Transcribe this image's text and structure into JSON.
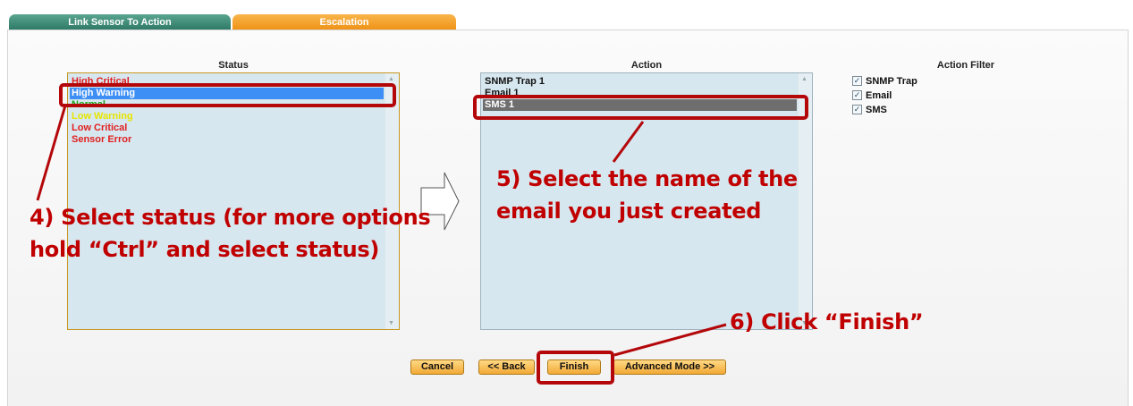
{
  "tabs": [
    {
      "label": "Link Sensor To Action",
      "color": "#3f8f79"
    },
    {
      "label": "Escalation",
      "color": "#f29d24"
    }
  ],
  "status": {
    "header": "Status",
    "items": [
      {
        "label": "High Critical",
        "color": "#e02020",
        "selected": false
      },
      {
        "label": "High Warning",
        "color": "#ffffff",
        "selected": true
      },
      {
        "label": "Normal",
        "color": "#1aa81a",
        "selected": false
      },
      {
        "label": "Low Warning",
        "color": "#e6e600",
        "selected": false
      },
      {
        "label": "Low Critical",
        "color": "#e02020",
        "selected": false
      },
      {
        "label": "Sensor Error",
        "color": "#e02020",
        "selected": false
      }
    ]
  },
  "action": {
    "header": "Action",
    "items": [
      {
        "label": "SNMP Trap 1",
        "selected": false
      },
      {
        "label": "Email 1",
        "selected": false
      },
      {
        "label": "SMS 1",
        "selected": true
      }
    ]
  },
  "action_filter": {
    "header": "Action Filter",
    "options": [
      {
        "label": "SNMP Trap",
        "checked": true
      },
      {
        "label": "Email",
        "checked": true
      },
      {
        "label": "SMS",
        "checked": true
      }
    ]
  },
  "buttons": {
    "cancel": "Cancel",
    "back": "<< Back",
    "finish": "Finish",
    "advanced": "Advanced Mode >>"
  },
  "annotations": {
    "step4_line1": "4) Select status (for more options",
    "step4_line2": "hold “Ctrl” and select status)",
    "step5_line1": "5) Select the name of the",
    "step5_line2": "email you just created",
    "step6": "6) Click “Finish”"
  },
  "colors": {
    "accent_green": "#3f8f79",
    "accent_orange": "#f29d24",
    "listbox_bg": "#d7e7ef",
    "status_selected": "#3d8ff5",
    "action_selected": "#6e6e6e",
    "annotation_red": "#c00000"
  }
}
